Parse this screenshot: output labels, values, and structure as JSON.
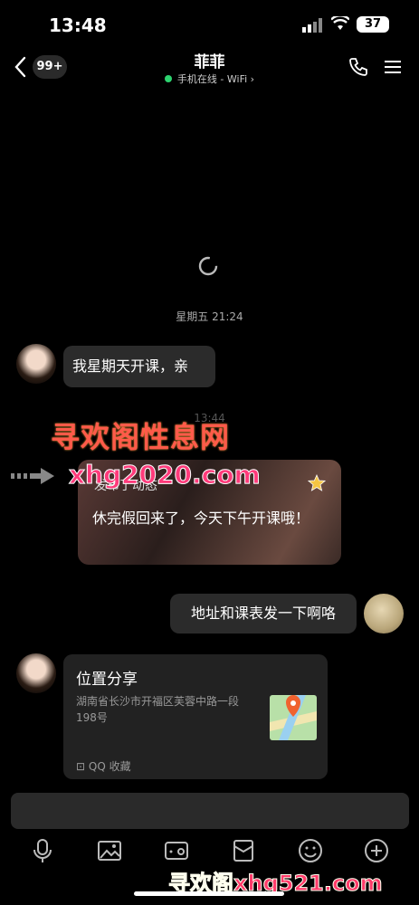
{
  "status_bar": {
    "time": "13:48",
    "battery": "37"
  },
  "header": {
    "unread_count": "99+",
    "title": "菲菲",
    "status": "手机在线 - WiFi",
    "status_chevron": "›"
  },
  "chat": {
    "timestamp_1": "星期五 21:24",
    "msg_1": "我星期天开课，亲",
    "timestamp_2": "13:44",
    "moment_header": "发布了动态",
    "moment_text": "休完假回来了，今天下午开课哦！",
    "msg_2": "地址和课表发一下啊咯",
    "location": {
      "title": "位置分享",
      "address": "湖南省长沙市开福区芙蓉中路一段198号",
      "source": "QQ 收藏"
    }
  },
  "watermarks": {
    "w1": "寻欢阁性息网",
    "w2": "xhg2020.com",
    "w3": "寻欢阁xhg521.com"
  },
  "icons": [
    "back-icon",
    "phone-icon",
    "menu-icon",
    "mic-icon",
    "image-icon",
    "camera-icon",
    "red-packet-icon",
    "emoji-icon",
    "plus-icon"
  ]
}
